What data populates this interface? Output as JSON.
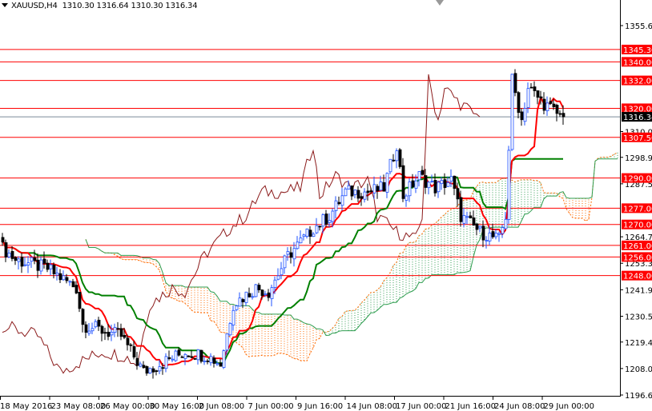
{
  "header": {
    "symbol": "XAUUSD,H4",
    "open": "1310.30",
    "high": "1316.64",
    "low": "1310.30",
    "close": "1316.34"
  },
  "chart_data": {
    "type": "candlestick",
    "title": "XAUUSD,H4",
    "indicator": "Ichimoku Kinko Hyo (9,26,52)",
    "ylim": [
      1196.6,
      1355.6
    ],
    "y_ticks": [
      "1355.60",
      "1310.00",
      "1298.90",
      "1287.50",
      "1264.70",
      "1253.30",
      "1241.90",
      "1230.50",
      "1219.40",
      "1208.00",
      "1196.60"
    ],
    "x_ticks": [
      "18 May 2016",
      "23 May 08:00",
      "26 May 00:00",
      "30 May 16:00",
      "2 Jun 08:00",
      "7 Jun 00:00",
      "9 Jun 16:00",
      "14 Jun 08:00",
      "17 Jun 00:00",
      "21 Jun 16:00",
      "24 Jun 08:00",
      "29 Jun 00:00"
    ],
    "close_path_waypoints": [
      [
        0,
        1259.9
      ],
      [
        4,
        1254.8
      ],
      [
        14,
        1251
      ],
      [
        23,
        1242.7
      ],
      [
        25,
        1227
      ],
      [
        32,
        1224
      ],
      [
        37,
        1222
      ],
      [
        44,
        1206.6
      ],
      [
        49,
        1210
      ],
      [
        57,
        1215.2
      ],
      [
        64,
        1213.5
      ],
      [
        68,
        1210
      ],
      [
        72,
        1235.8
      ],
      [
        79,
        1242.7
      ],
      [
        83,
        1241
      ],
      [
        89,
        1256.5
      ],
      [
        97,
        1268.5
      ],
      [
        102,
        1273.7
      ],
      [
        107,
        1284
      ],
      [
        114,
        1284
      ],
      [
        119,
        1285.7
      ],
      [
        123,
        1304.7
      ],
      [
        125,
        1282.3
      ],
      [
        130,
        1290.9
      ],
      [
        135,
        1285.7
      ],
      [
        140,
        1289
      ],
      [
        143,
        1273.7
      ],
      [
        149,
        1266.8
      ],
      [
        155,
        1263.4
      ],
      [
        157,
        1273.7
      ],
      [
        159,
        1332.2
      ],
      [
        162,
        1315
      ],
      [
        164,
        1328.8
      ],
      [
        169,
        1322
      ],
      [
        175,
        1315.7
      ]
    ],
    "last_price": {
      "value": 1316.34,
      "label": "1316.34"
    },
    "levels": [
      {
        "value": 1345.3,
        "label": "1345.30"
      },
      {
        "value": 1340.0,
        "label": "1340.00"
      },
      {
        "value": 1332.0,
        "label": "1332.00"
      },
      {
        "value": 1320.0,
        "label": "1320.00"
      },
      {
        "value": 1307.5,
        "label": "1307.50"
      },
      {
        "value": 1290.0,
        "label": "1290.00"
      },
      {
        "value": 1277.0,
        "label": "1277.00"
      },
      {
        "value": 1270.0,
        "label": "1270.00"
      },
      {
        "value": 1261.0,
        "label": "1261.00"
      },
      {
        "value": 1256.0,
        "label": "1256.00"
      },
      {
        "value": 1248.0,
        "label": "1248.00"
      }
    ],
    "colors": {
      "level": "#ff0000",
      "tenkan": "#ff0000",
      "kijun": "#008000",
      "chikou": "#8b1a1a",
      "cloud_up": "#2e9d4f",
      "cloud_down": "#ff6a00",
      "bull": "#1e50ff",
      "bear": "#000000",
      "last": "#000000"
    }
  }
}
